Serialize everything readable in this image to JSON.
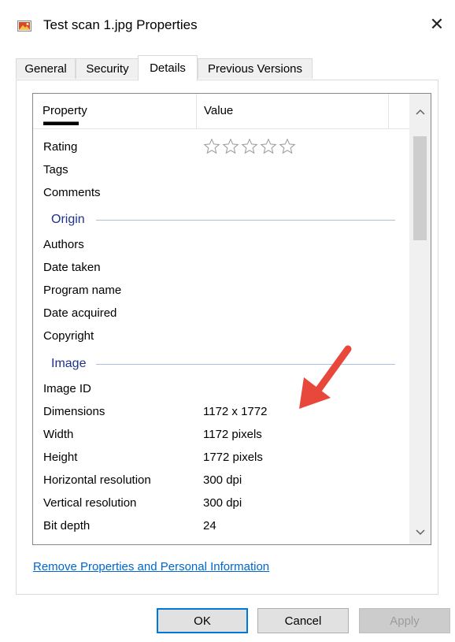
{
  "window": {
    "title": "Test scan 1.jpg Properties",
    "close_glyph": "✕",
    "icon": "image-file-icon"
  },
  "tabs": [
    {
      "label": "General",
      "active": false
    },
    {
      "label": "Security",
      "active": false
    },
    {
      "label": "Details",
      "active": true
    },
    {
      "label": "Previous Versions",
      "active": false
    }
  ],
  "grid": {
    "headers": {
      "property": "Property",
      "value": "Value"
    },
    "rows": {
      "rating": {
        "property": "Rating",
        "stars": 5,
        "filled": 0
      },
      "tags": {
        "property": "Tags",
        "value": ""
      },
      "comments": {
        "property": "Comments",
        "value": ""
      },
      "origin_group": "Origin",
      "authors": {
        "property": "Authors",
        "value": ""
      },
      "date_taken": {
        "property": "Date taken",
        "value": ""
      },
      "program_name": {
        "property": "Program name",
        "value": ""
      },
      "date_acquired": {
        "property": "Date acquired",
        "value": ""
      },
      "copyright": {
        "property": "Copyright",
        "value": ""
      },
      "image_group": "Image",
      "image_id": {
        "property": "Image ID",
        "value": ""
      },
      "dimensions": {
        "property": "Dimensions",
        "value": "1172 x 1772"
      },
      "width": {
        "property": "Width",
        "value": "1172 pixels"
      },
      "height": {
        "property": "Height",
        "value": "1772 pixels"
      },
      "hres": {
        "property": "Horizontal resolution",
        "value": "300 dpi"
      },
      "vres": {
        "property": "Vertical resolution",
        "value": "300 dpi"
      },
      "bit_depth": {
        "property": "Bit depth",
        "value": "24"
      }
    }
  },
  "link": "Remove Properties and Personal Information",
  "buttons": {
    "ok": "OK",
    "cancel": "Cancel",
    "apply": "Apply"
  },
  "colors": {
    "accent": "#0078d7",
    "group_text": "#1e3287",
    "link": "#0066cc",
    "annotation_arrow": "#e8473b"
  }
}
